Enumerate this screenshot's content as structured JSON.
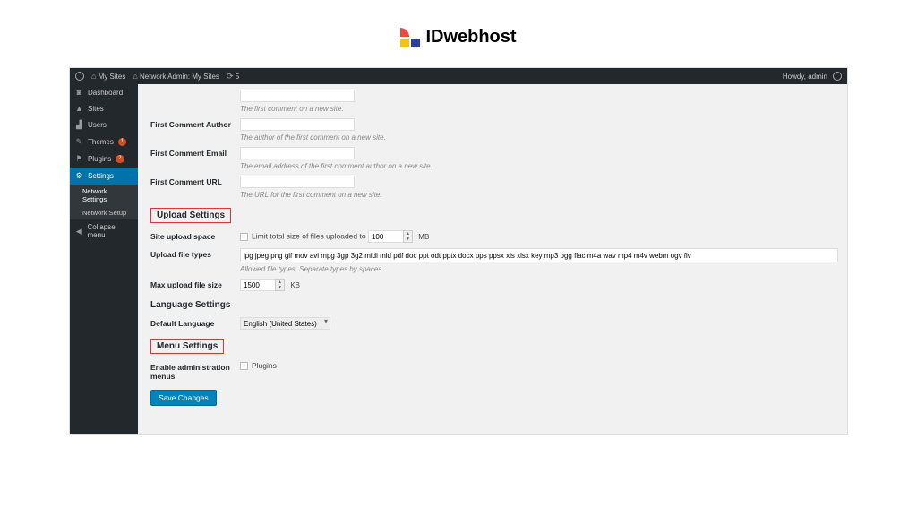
{
  "brand": {
    "text": "IDwebhost"
  },
  "adminbar": {
    "items": [
      "My Sites",
      "Network Admin: My Sites"
    ],
    "updates": "5",
    "howdy": "Howdy, admin"
  },
  "sidebar": {
    "dashboard": "Dashboard",
    "sites": "Sites",
    "users": "Users",
    "themes": "Themes",
    "themes_badge": "1",
    "plugins": "Plugins",
    "plugins_badge": "2",
    "settings": "Settings",
    "sub_network": "Network Settings",
    "sub_setup": "Network Setup",
    "collapse": "Collapse menu"
  },
  "form": {
    "first_comment_hint": "The first comment on a new site.",
    "first_author_lab": "First Comment Author",
    "first_author_hint": "The author of the first comment on a new site.",
    "first_email_lab": "First Comment Email",
    "first_email_hint": "The email address of the first comment author on a new site.",
    "first_url_lab": "First Comment URL",
    "first_url_hint": "The URL for the first comment on a new site.",
    "upload_heading": "Upload Settings",
    "space_lab": "Site upload space",
    "space_cb": "Limit total size of files uploaded to",
    "space_val": "100",
    "space_unit": "MB",
    "types_lab": "Upload file types",
    "types_val": "jpg jpeg png gif mov avi mpg 3gp 3g2 midi mid pdf doc ppt odt pptx docx pps ppsx xls xlsx key mp3 ogg flac m4a wav mp4 m4v webm ogv flv",
    "types_hint": "Allowed file types. Separate types by spaces.",
    "max_lab": "Max upload file size",
    "max_val": "1500",
    "max_unit": "KB",
    "lang_heading": "Language Settings",
    "lang_lab": "Default Language",
    "lang_val": "English (United States)",
    "menu_heading": "Menu Settings",
    "menu_lab": "Enable administration menus",
    "menu_cb": "Plugins",
    "save": "Save Changes"
  }
}
